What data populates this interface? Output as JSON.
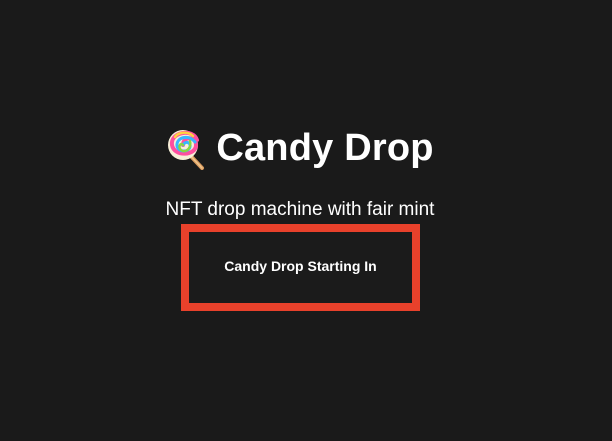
{
  "app": {
    "title": "Candy Drop",
    "icon": "lollipop-icon",
    "subtitle": "NFT drop machine with fair mint"
  },
  "cta": {
    "label": "Candy Drop Starting In",
    "border_color": "#e8412b"
  },
  "colors": {
    "background": "#1a1a1a",
    "text": "#ffffff",
    "accent": "#e8412b"
  }
}
